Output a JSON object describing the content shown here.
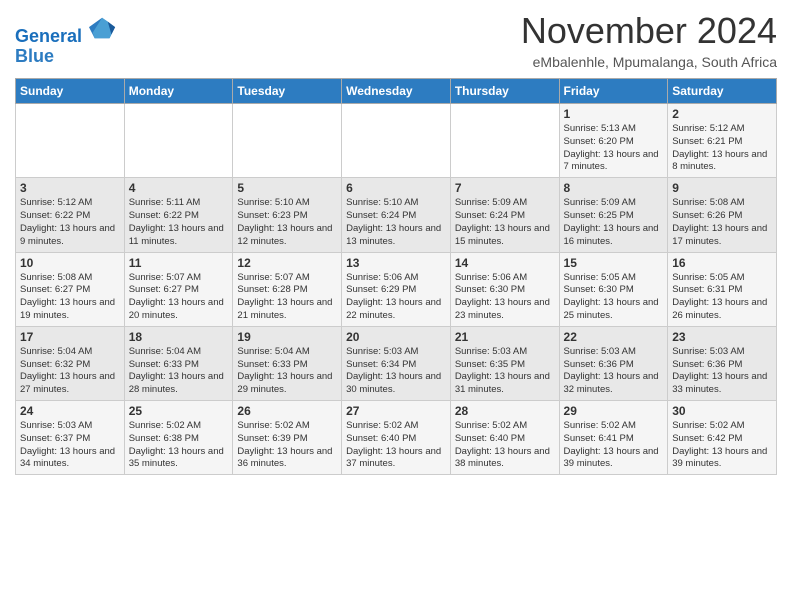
{
  "logo": {
    "line1": "General",
    "line2": "Blue"
  },
  "title": "November 2024",
  "location": "eMbalenhle, Mpumalanga, South Africa",
  "weekdays": [
    "Sunday",
    "Monday",
    "Tuesday",
    "Wednesday",
    "Thursday",
    "Friday",
    "Saturday"
  ],
  "weeks": [
    [
      {
        "day": "",
        "info": ""
      },
      {
        "day": "",
        "info": ""
      },
      {
        "day": "",
        "info": ""
      },
      {
        "day": "",
        "info": ""
      },
      {
        "day": "",
        "info": ""
      },
      {
        "day": "1",
        "info": "Sunrise: 5:13 AM\nSunset: 6:20 PM\nDaylight: 13 hours and 7 minutes."
      },
      {
        "day": "2",
        "info": "Sunrise: 5:12 AM\nSunset: 6:21 PM\nDaylight: 13 hours and 8 minutes."
      }
    ],
    [
      {
        "day": "3",
        "info": "Sunrise: 5:12 AM\nSunset: 6:22 PM\nDaylight: 13 hours and 9 minutes."
      },
      {
        "day": "4",
        "info": "Sunrise: 5:11 AM\nSunset: 6:22 PM\nDaylight: 13 hours and 11 minutes."
      },
      {
        "day": "5",
        "info": "Sunrise: 5:10 AM\nSunset: 6:23 PM\nDaylight: 13 hours and 12 minutes."
      },
      {
        "day": "6",
        "info": "Sunrise: 5:10 AM\nSunset: 6:24 PM\nDaylight: 13 hours and 13 minutes."
      },
      {
        "day": "7",
        "info": "Sunrise: 5:09 AM\nSunset: 6:24 PM\nDaylight: 13 hours and 15 minutes."
      },
      {
        "day": "8",
        "info": "Sunrise: 5:09 AM\nSunset: 6:25 PM\nDaylight: 13 hours and 16 minutes."
      },
      {
        "day": "9",
        "info": "Sunrise: 5:08 AM\nSunset: 6:26 PM\nDaylight: 13 hours and 17 minutes."
      }
    ],
    [
      {
        "day": "10",
        "info": "Sunrise: 5:08 AM\nSunset: 6:27 PM\nDaylight: 13 hours and 19 minutes."
      },
      {
        "day": "11",
        "info": "Sunrise: 5:07 AM\nSunset: 6:27 PM\nDaylight: 13 hours and 20 minutes."
      },
      {
        "day": "12",
        "info": "Sunrise: 5:07 AM\nSunset: 6:28 PM\nDaylight: 13 hours and 21 minutes."
      },
      {
        "day": "13",
        "info": "Sunrise: 5:06 AM\nSunset: 6:29 PM\nDaylight: 13 hours and 22 minutes."
      },
      {
        "day": "14",
        "info": "Sunrise: 5:06 AM\nSunset: 6:30 PM\nDaylight: 13 hours and 23 minutes."
      },
      {
        "day": "15",
        "info": "Sunrise: 5:05 AM\nSunset: 6:30 PM\nDaylight: 13 hours and 25 minutes."
      },
      {
        "day": "16",
        "info": "Sunrise: 5:05 AM\nSunset: 6:31 PM\nDaylight: 13 hours and 26 minutes."
      }
    ],
    [
      {
        "day": "17",
        "info": "Sunrise: 5:04 AM\nSunset: 6:32 PM\nDaylight: 13 hours and 27 minutes."
      },
      {
        "day": "18",
        "info": "Sunrise: 5:04 AM\nSunset: 6:33 PM\nDaylight: 13 hours and 28 minutes."
      },
      {
        "day": "19",
        "info": "Sunrise: 5:04 AM\nSunset: 6:33 PM\nDaylight: 13 hours and 29 minutes."
      },
      {
        "day": "20",
        "info": "Sunrise: 5:03 AM\nSunset: 6:34 PM\nDaylight: 13 hours and 30 minutes."
      },
      {
        "day": "21",
        "info": "Sunrise: 5:03 AM\nSunset: 6:35 PM\nDaylight: 13 hours and 31 minutes."
      },
      {
        "day": "22",
        "info": "Sunrise: 5:03 AM\nSunset: 6:36 PM\nDaylight: 13 hours and 32 minutes."
      },
      {
        "day": "23",
        "info": "Sunrise: 5:03 AM\nSunset: 6:36 PM\nDaylight: 13 hours and 33 minutes."
      }
    ],
    [
      {
        "day": "24",
        "info": "Sunrise: 5:03 AM\nSunset: 6:37 PM\nDaylight: 13 hours and 34 minutes."
      },
      {
        "day": "25",
        "info": "Sunrise: 5:02 AM\nSunset: 6:38 PM\nDaylight: 13 hours and 35 minutes."
      },
      {
        "day": "26",
        "info": "Sunrise: 5:02 AM\nSunset: 6:39 PM\nDaylight: 13 hours and 36 minutes."
      },
      {
        "day": "27",
        "info": "Sunrise: 5:02 AM\nSunset: 6:40 PM\nDaylight: 13 hours and 37 minutes."
      },
      {
        "day": "28",
        "info": "Sunrise: 5:02 AM\nSunset: 6:40 PM\nDaylight: 13 hours and 38 minutes."
      },
      {
        "day": "29",
        "info": "Sunrise: 5:02 AM\nSunset: 6:41 PM\nDaylight: 13 hours and 39 minutes."
      },
      {
        "day": "30",
        "info": "Sunrise: 5:02 AM\nSunset: 6:42 PM\nDaylight: 13 hours and 39 minutes."
      }
    ]
  ]
}
